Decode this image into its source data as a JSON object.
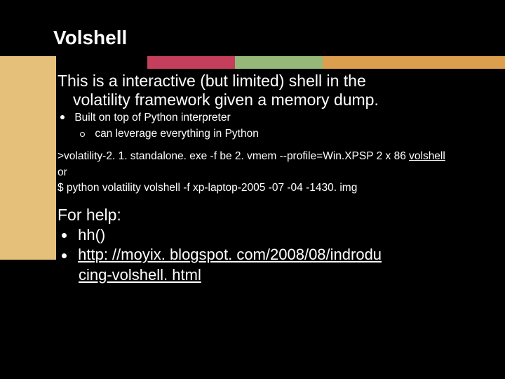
{
  "title": "Volshell",
  "intro_line1": "This is a interactive (but limited) shell in the",
  "intro_line2": "volatility framework given a memory dump.",
  "bullet1": "Built on top of Python interpreter",
  "sub1": "can leverage everything in Python",
  "cmd1_prefix": ">volatility-2. 1. standalone. exe -f be 2. vmem  --profile=Win.XPSP 2 x 86 ",
  "cmd1_vol": "volshell",
  "cmd_or": "or",
  "cmd2": "$ python volatility volshell -f xp-laptop-2005 -07 -04 -1430. img",
  "help_heading": "For help:",
  "help_item1": "hh()",
  "help_link_l1": "http: //moyix. blogspot. com/2008/08/indrodu",
  "help_link_l2": "cing-volshell. html"
}
